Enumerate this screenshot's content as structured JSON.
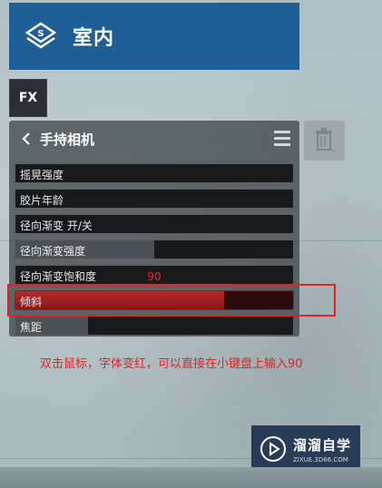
{
  "header": {
    "title": "室内",
    "logo_icon": "layers-s-icon",
    "bg_color": "#1f5f96"
  },
  "fx_button": {
    "label": "FX"
  },
  "panel": {
    "title": "手持相机",
    "back_icon": "chevron-left-icon",
    "menu_icon": "hamburger-menu-icon",
    "trash_icon": "trash-fx-icon",
    "sliders": [
      {
        "label": "摇晃强度",
        "value": 0
      },
      {
        "label": "胶片年龄",
        "value": 0
      },
      {
        "label": "径向渐变 开/关",
        "value": 0
      },
      {
        "label": "径向渐变强度",
        "value": 50
      },
      {
        "label": "径向渐变饱和度",
        "value": 0
      },
      {
        "label": "倾斜",
        "value": 75,
        "active": true
      },
      {
        "label": "焦距",
        "value": 26
      }
    ]
  },
  "value_badge": "90",
  "annotation": "双击鼠标，字体变红，可以直接在小键盘上输入90",
  "watermark": {
    "name": "溜溜自学",
    "url": "ZIXUE.3D66.COM"
  },
  "colors": {
    "accent_red": "#e02424",
    "panel_bg": "#3c4448"
  }
}
